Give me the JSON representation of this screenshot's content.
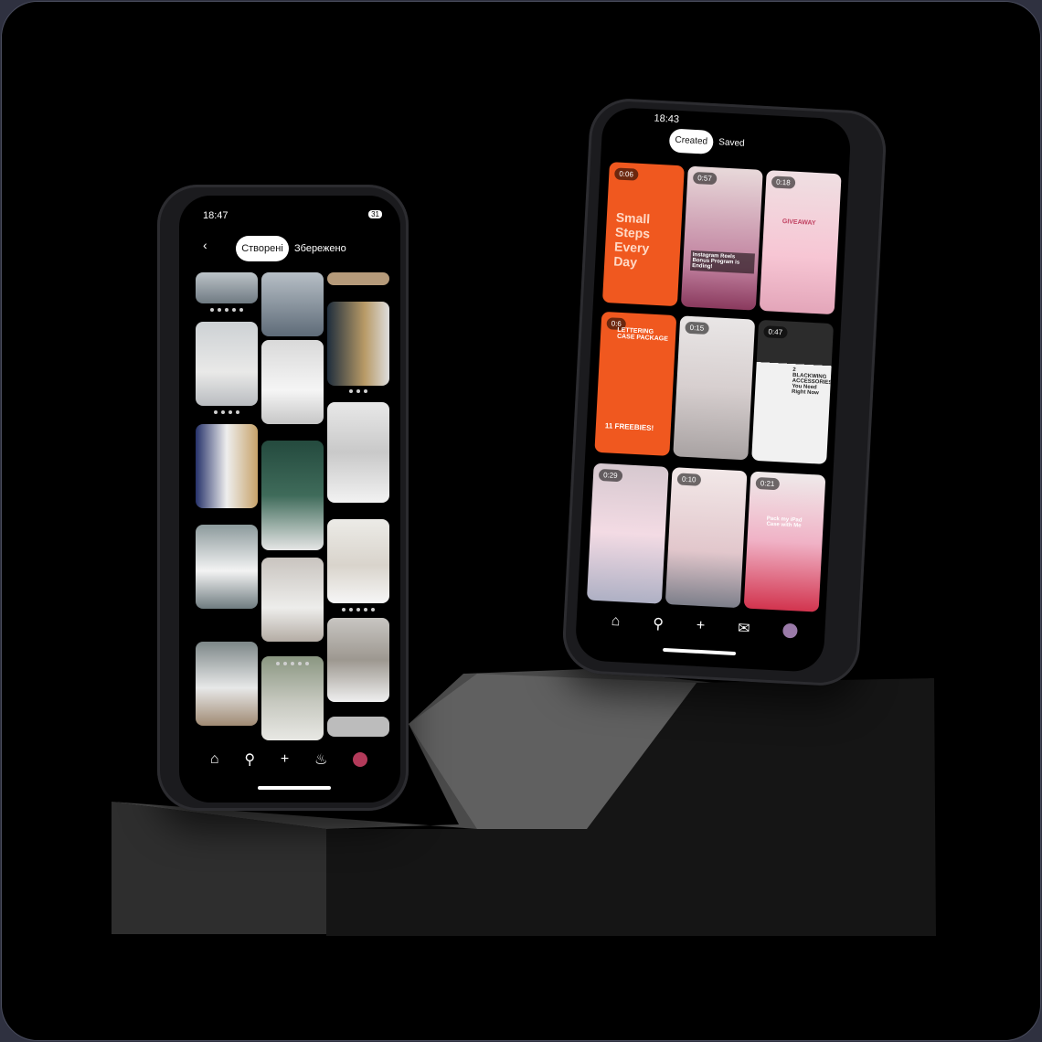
{
  "left_phone": {
    "status_time": "18:47",
    "battery": "31",
    "tab_created": "Створені",
    "tab_saved": "Збережено",
    "nav_icons": [
      "home-icon",
      "search-icon",
      "plus-icon",
      "bell-icon",
      "avatar"
    ]
  },
  "right_phone": {
    "status_time": "18:43",
    "tab_created": "Created",
    "tab_saved": "Saved",
    "tiles": [
      {
        "duration": "0:06",
        "caption": "Small Steps Every Day"
      },
      {
        "duration": "0:57",
        "caption": "Instagram Reels Bonus Program is Ending!"
      },
      {
        "duration": "0:18",
        "caption": "GIVEAWAY"
      },
      {
        "duration": "0:6",
        "caption": "LETTERING CASE PACKAGE"
      },
      {
        "duration": "0:15",
        "caption": ""
      },
      {
        "duration": "0:47",
        "caption": "2 BLACKWING ACCESSORIES You Need Right Now"
      },
      {
        "duration": "0:29",
        "caption": ""
      },
      {
        "duration": "0:10",
        "caption": ""
      },
      {
        "duration": "0:21",
        "caption": "Pack my iPad Case with Me"
      }
    ],
    "tile_extra": "11 FREEBIES!",
    "nav_icons": [
      "home-icon",
      "search-icon",
      "plus-icon",
      "chat-icon",
      "avatar"
    ]
  },
  "colors": {
    "orange": "#f0581f",
    "pink": "#ea9cbf",
    "frame_border": "#4a4d5e"
  }
}
